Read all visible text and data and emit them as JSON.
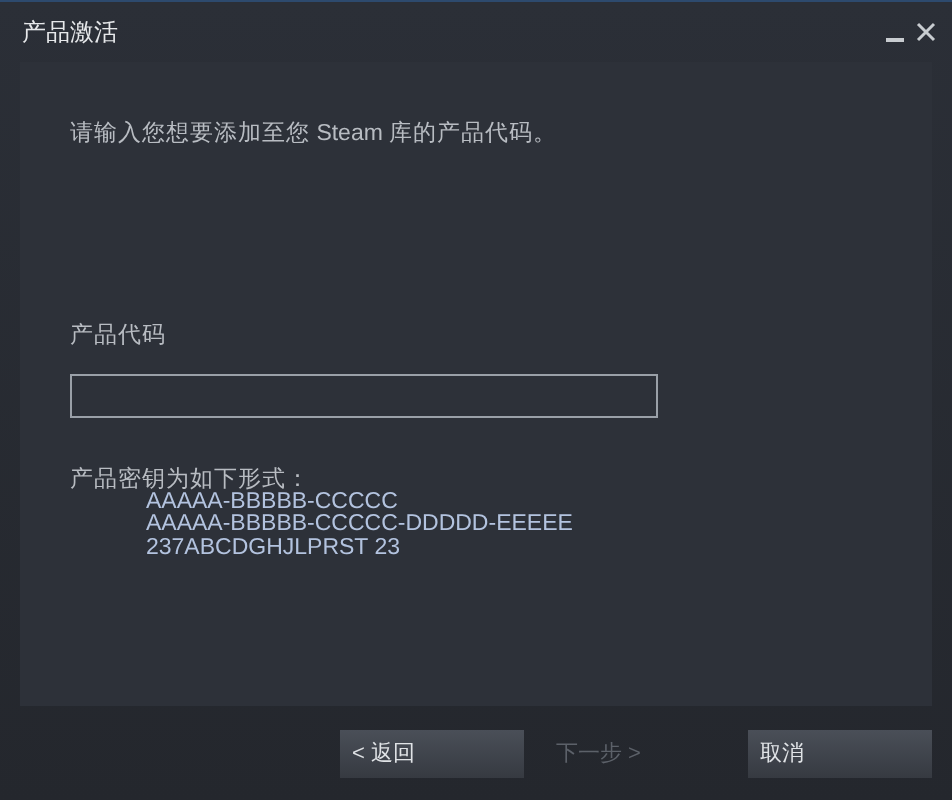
{
  "window": {
    "title": "产品激活",
    "controls": [
      {
        "kind": "minimize"
      },
      {
        "kind": "close"
      }
    ]
  },
  "instruction": "请输入您想要添加至您 Steam 库的产品代码。",
  "code_field": {
    "label": "产品代码"
  },
  "format": {
    "label": "产品密钥为如下形式：",
    "examples": [
      "AAAAA-BBBBB-CCCCC",
      "AAAAA-BBBBB-CCCCC-DDDDD-EEEEE",
      "237ABCDGHJLPRST 23"
    ]
  },
  "buttons": [
    {
      "label": "< 返回",
      "disabled": false
    },
    {
      "label": "下一步 >",
      "disabled": true
    },
    {
      "label": "取消",
      "disabled": false
    }
  ]
}
